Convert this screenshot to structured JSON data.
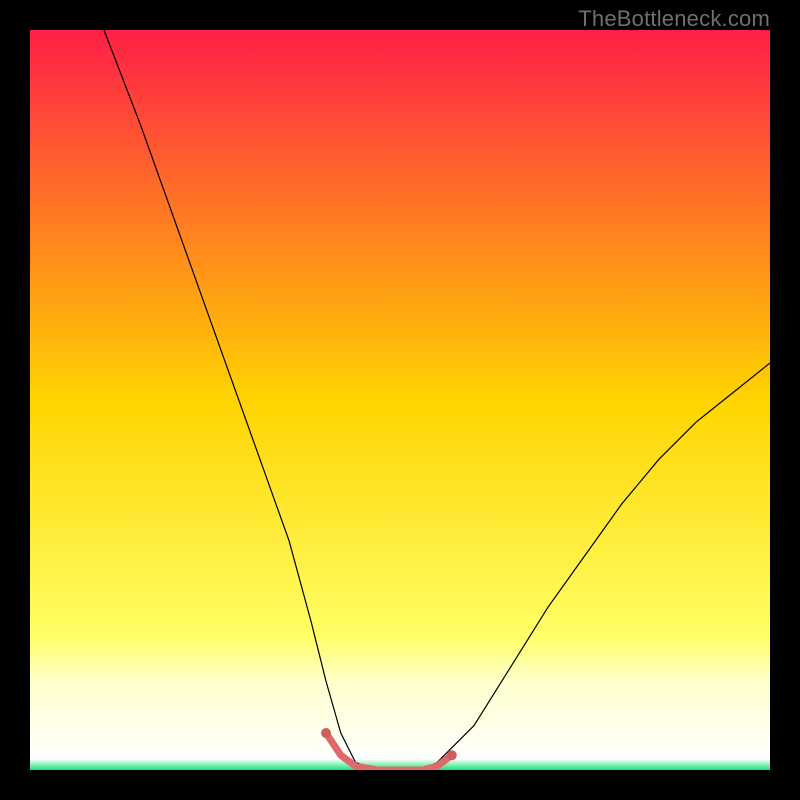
{
  "watermark": "TheBottleneck.com",
  "chart_data": {
    "type": "line",
    "title": "",
    "xlabel": "",
    "ylabel": "",
    "xlim": [
      0,
      100
    ],
    "ylim": [
      0,
      100
    ],
    "grid": false,
    "legend": false,
    "background_gradient": {
      "stops": [
        {
          "offset": 0.0,
          "color": "#ff1f47"
        },
        {
          "offset": 0.5,
          "color": "#ffd400"
        },
        {
          "offset": 0.82,
          "color": "#ffff66"
        },
        {
          "offset": 0.88,
          "color": "#ffffcc"
        },
        {
          "offset": 0.985,
          "color": "#ffffff"
        },
        {
          "offset": 1.0,
          "color": "#17e575"
        }
      ]
    },
    "series": [
      {
        "name": "bottleneck-curve",
        "stroke": "#000000",
        "stroke_width": 1.2,
        "x": [
          10,
          15,
          20,
          25,
          30,
          35,
          38,
          40,
          42,
          44,
          47,
          50,
          53,
          55,
          60,
          65,
          70,
          75,
          80,
          85,
          90,
          95,
          100
        ],
        "values": [
          100,
          87,
          73,
          59,
          45,
          31,
          20,
          12,
          5,
          1,
          0,
          0,
          0,
          1,
          6,
          14,
          22,
          29,
          36,
          42,
          47,
          51,
          55
        ]
      },
      {
        "name": "flat-zone-highlight",
        "stroke": "#e06a6a",
        "stroke_width": 7,
        "x": [
          40,
          42,
          44,
          47,
          50,
          53,
          55,
          57
        ],
        "values": [
          5,
          2,
          0.5,
          0,
          0,
          0,
          0.5,
          2
        ]
      }
    ],
    "markers": {
      "name": "flat-zone-dots",
      "color": "#cf5d5d",
      "radius": 5,
      "x": [
        40,
        57
      ],
      "values": [
        5,
        2
      ]
    }
  }
}
